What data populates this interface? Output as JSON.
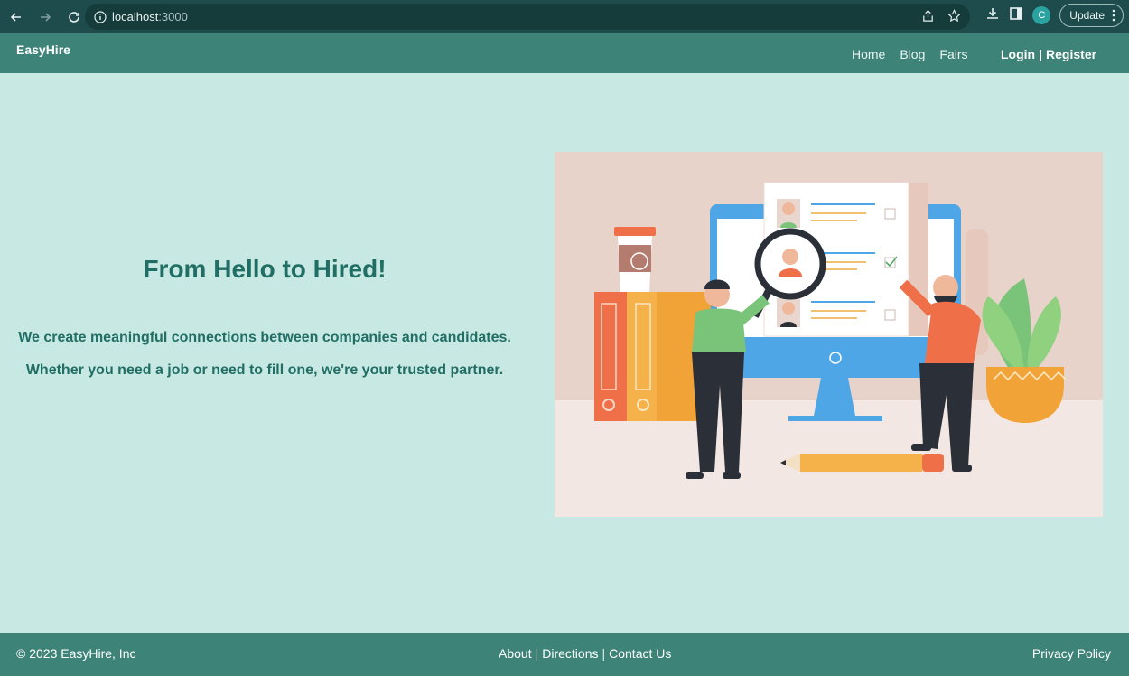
{
  "browser": {
    "url_host": "localhost",
    "url_port": ":3000",
    "avatar_letter": "C",
    "update_label": "Update"
  },
  "header": {
    "brand": "EasyHire",
    "nav": [
      "Home",
      "Blog",
      "Fairs"
    ],
    "login": "Login",
    "separator": "|",
    "register": "Register"
  },
  "hero": {
    "title": "From Hello to Hired!",
    "line1": "We create meaningful connections between companies and candidates.",
    "line2": "Whether you need a job or need to fill one, we're your trusted partner."
  },
  "footer": {
    "copyright": "© 2023 EasyHire, Inc",
    "links": [
      "About",
      "Directions",
      "Contact Us"
    ],
    "separator": "|",
    "privacy": "Privacy Policy"
  },
  "colors": {
    "page_bg": "#c8e8e3",
    "header_bg": "#3d8378",
    "accent_text": "#206e64",
    "chrome_bg": "#1e4b4b"
  }
}
